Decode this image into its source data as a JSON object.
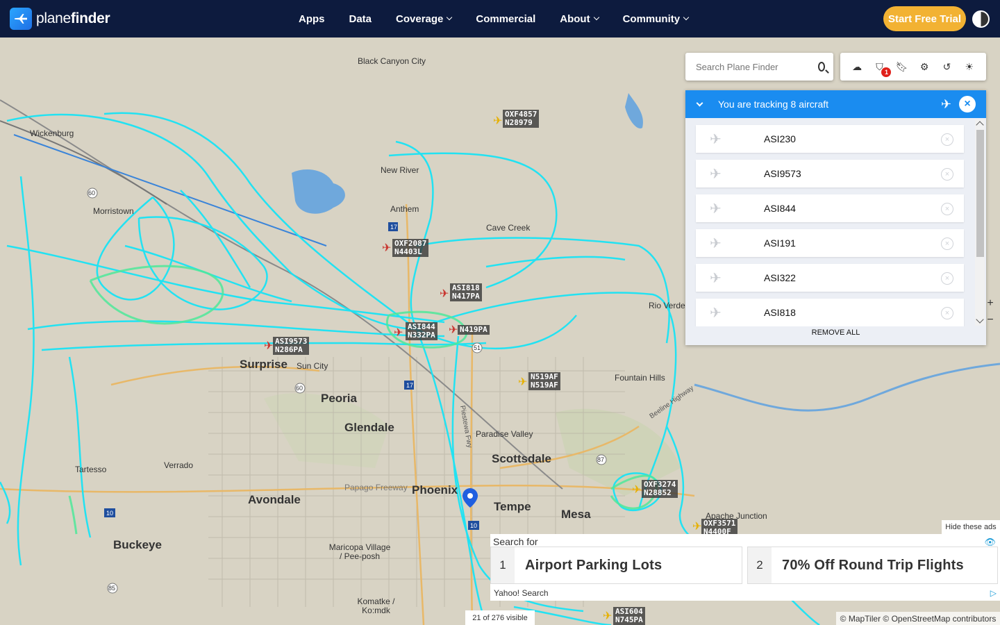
{
  "brand": {
    "name_plain": "plane",
    "name_bold": "finder"
  },
  "nav": {
    "items": [
      {
        "label": "Apps",
        "dropdown": false
      },
      {
        "label": "Data",
        "dropdown": false
      },
      {
        "label": "Coverage",
        "dropdown": true
      },
      {
        "label": "Commercial",
        "dropdown": false
      },
      {
        "label": "About",
        "dropdown": true
      },
      {
        "label": "Community",
        "dropdown": true
      }
    ],
    "cta_label": "Start Free Trial"
  },
  "search": {
    "placeholder": "Search Plane Finder"
  },
  "toolbar": {
    "icons": [
      "cloud-upload-icon",
      "filter-icon",
      "bookmark-icon",
      "settings-icon",
      "history-icon",
      "weather-icon"
    ],
    "filter_badge": "1"
  },
  "tracking": {
    "title": "You are tracking 8 aircraft",
    "items": [
      "ASI230",
      "ASI9573",
      "ASI844",
      "ASI191",
      "ASI322",
      "ASI818"
    ],
    "remove_all": "REMOVE ALL"
  },
  "map": {
    "places": [
      {
        "name": "Black Canyon City",
        "style": "small"
      },
      {
        "name": "Wickenburg",
        "style": "small"
      },
      {
        "name": "New River",
        "style": "small"
      },
      {
        "name": "Anthem",
        "style": "small"
      },
      {
        "name": "Morristown",
        "style": "small"
      },
      {
        "name": "Cave Creek",
        "style": "small"
      },
      {
        "name": "Rio Verde",
        "style": "small"
      },
      {
        "name": "Fountain Hills",
        "style": "small"
      },
      {
        "name": "Surprise",
        "style": "big"
      },
      {
        "name": "Sun City",
        "style": "small"
      },
      {
        "name": "Peoria",
        "style": "big"
      },
      {
        "name": "Glendale",
        "style": "big"
      },
      {
        "name": "Paradise Valley",
        "style": "small"
      },
      {
        "name": "Scottsdale",
        "style": "big"
      },
      {
        "name": "Tartesso",
        "style": "small"
      },
      {
        "name": "Verrado",
        "style": "small"
      },
      {
        "name": "Avondale",
        "style": "big"
      },
      {
        "name": "Papago Freeway",
        "style": "small"
      },
      {
        "name": "Phoenix",
        "style": "big"
      },
      {
        "name": "Tempe",
        "style": "big"
      },
      {
        "name": "Mesa",
        "style": "big"
      },
      {
        "name": "Apache Junction",
        "style": "small"
      },
      {
        "name": "Buckeye",
        "style": "big"
      },
      {
        "name": "Maricopa Village / Pee-posh",
        "style": "small"
      },
      {
        "name": "Komatke / Ko:mdk",
        "style": "small"
      },
      {
        "name": "Piestewa Fwy",
        "style": "small"
      },
      {
        "name": "Beeline Highway",
        "style": "small"
      }
    ],
    "flights": [
      {
        "line1": "OXF4857",
        "line2": "N28979",
        "color": "yellow"
      },
      {
        "line1": "OXF2087",
        "line2": "N4403L",
        "color": "red"
      },
      {
        "line1": "ASI818",
        "line2": "N417PA",
        "color": "red"
      },
      {
        "line1": "ASI844",
        "line2": "N332PA",
        "color": "red"
      },
      {
        "line1": "N419PA",
        "line2": "",
        "color": "red"
      },
      {
        "line1": "ASI9573",
        "line2": "N286PA",
        "color": "red"
      },
      {
        "line1": "N519AF",
        "line2": "N519AF",
        "color": "yellow"
      },
      {
        "line1": "OXF3274",
        "line2": "N28852",
        "color": "yellow"
      },
      {
        "line1": "OXF3571",
        "line2": "N4400F",
        "color": "yellow"
      },
      {
        "line1": "ASI604",
        "line2": "N745PA",
        "color": "yellow"
      }
    ],
    "visible_count": "21 of 276 visible",
    "attribution": "© MapTiler © OpenStreetMap contributors",
    "colors": {
      "track": "#19e3f5",
      "track_dense": "#4fe89a",
      "water": "#6fa8dc",
      "highway": "#e8b868"
    }
  },
  "ads": {
    "hide_label": "Hide these ads",
    "search_for": "Search for",
    "items": [
      {
        "num": "1",
        "text": "Airport Parking Lots"
      },
      {
        "num": "2",
        "text": "70% Off Round Trip Flights"
      }
    ],
    "footer": "Yahoo! Search"
  }
}
